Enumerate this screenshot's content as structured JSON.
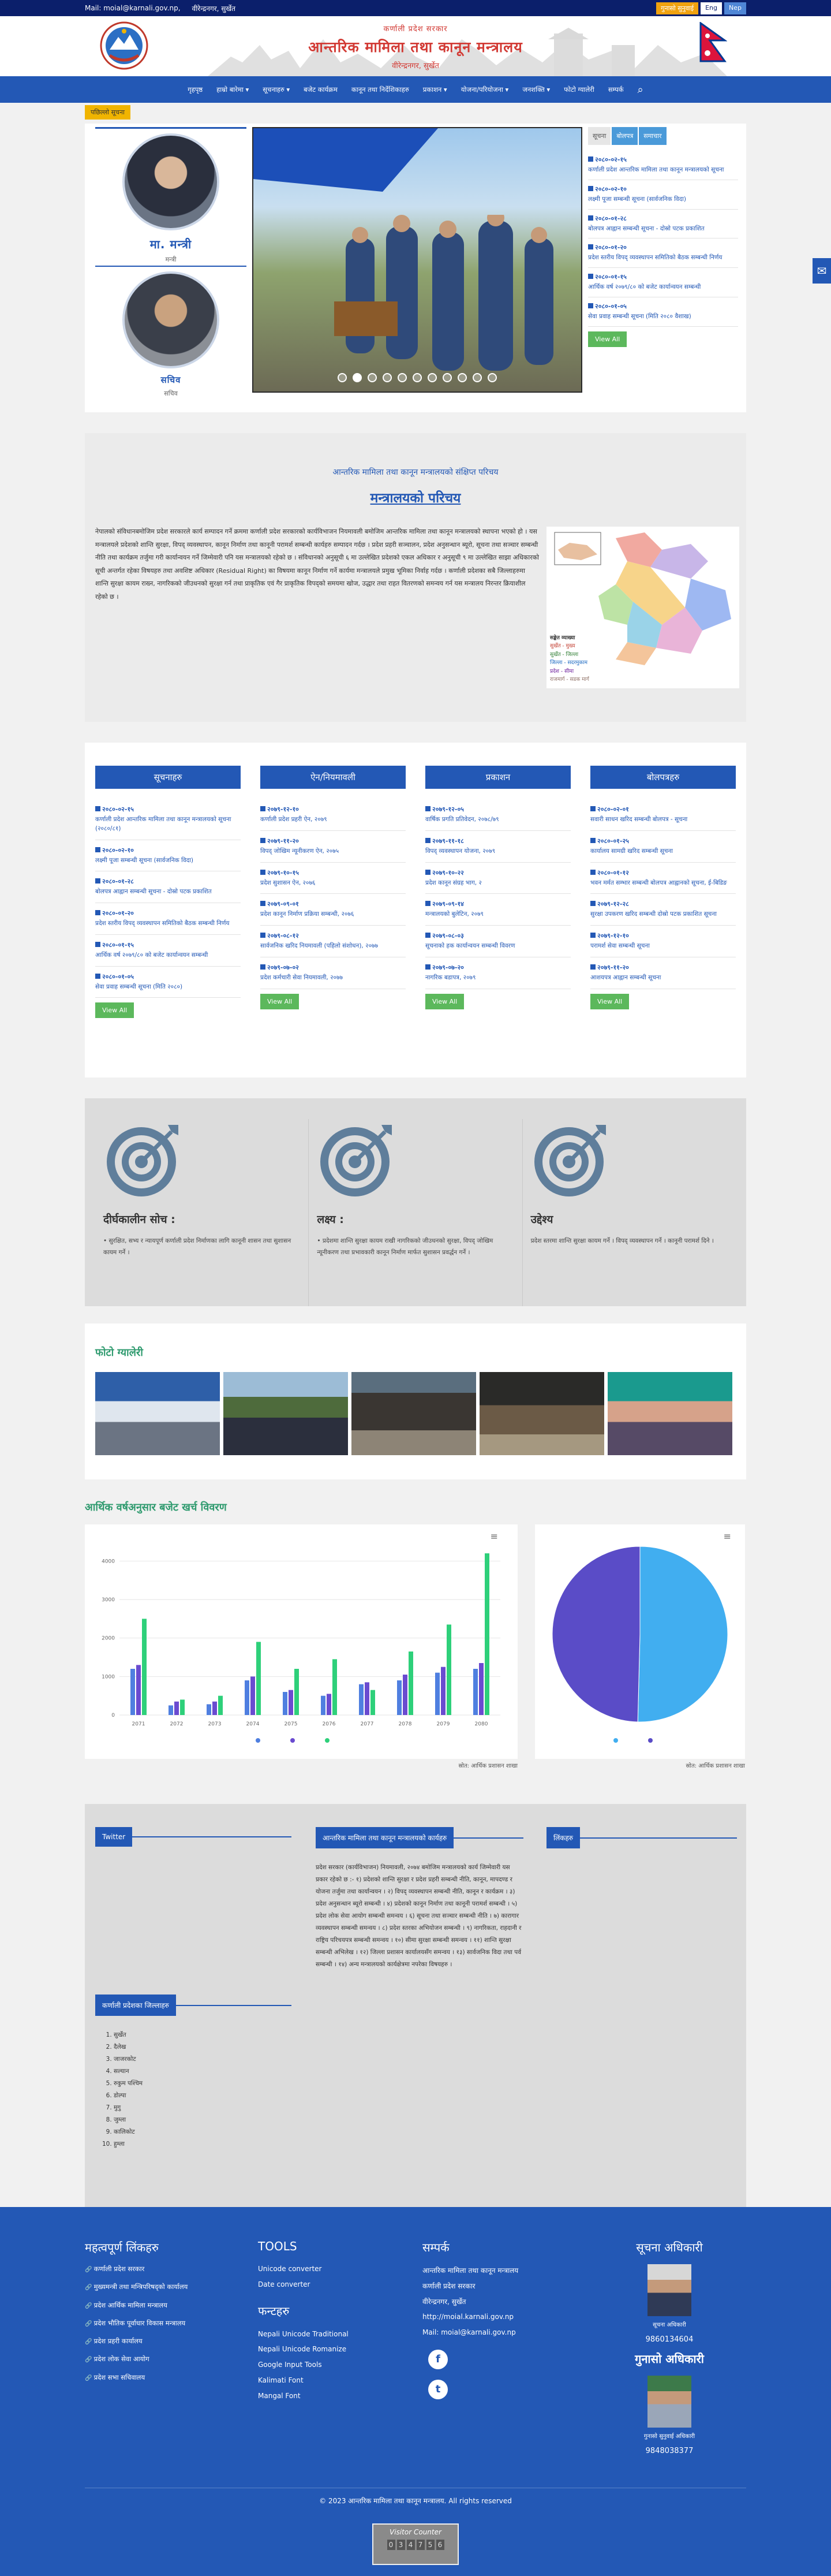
{
  "topbar": {
    "mail": "Mail: moial@karnali.gov.np,",
    "address": "वीरेन्द्रनगर, सुर्खेत",
    "orange_btn": "गुनासो सुनुवाई",
    "eng": "Eng",
    "nep": "Nep"
  },
  "header": {
    "line1": "कर्णाली प्रदेश सरकार",
    "line2": "आन्तरिक मामिला तथा कानून मन्त्रालय",
    "line3": "वीरेन्द्रनगर, सुर्खेत"
  },
  "nav": {
    "items": [
      "गृहपृष्ठ",
      "हाम्रो बारेमा ▾",
      "सूचनाहरु ▾",
      "बजेट कार्यक्रम",
      "कानून तथा निर्देशिकाहरु",
      "प्रकाशन ▾",
      "योजना/परियोजना ▾",
      "जनशक्ति ▾",
      "फोटो ग्यालेरी",
      "सम्पर्क"
    ],
    "search": "⌕"
  },
  "badge": "पछिल्लो सूचना",
  "officials": [
    {
      "name": "मा. मन्त्री",
      "role": "मन्त्री"
    },
    {
      "name": "सचिव",
      "role": "सचिव"
    }
  ],
  "tabs": [
    "सूचना",
    "बोलपत्र",
    "समाचार"
  ],
  "news_top": [
    {
      "date": "२०८०-०२-१५",
      "title": "कर्णाली प्रदेश आन्तरिक मामिला तथा कानून मन्त्रालयको सूचना"
    },
    {
      "date": "२०८०-०२-१०",
      "title": "लक्ष्मी पूजा सम्बन्धी सूचना (सार्वजनिक विदा)"
    },
    {
      "date": "२०८०-०१-२८",
      "title": "बोलपत्र आह्वान सम्बन्धी सूचना - दोस्रो पटक प्रकाशित"
    },
    {
      "date": "२०८०-०१-२०",
      "title": "प्रदेश स्तरीय विपद् व्यवस्थापन समितिको बैठक सम्बन्धी निर्णय"
    },
    {
      "date": "२०८०-०१-१५",
      "title": "आर्थिक वर्ष २०७९/८० को बजेट कार्यान्वयन सम्बन्धी"
    },
    {
      "date": "२०८०-०१-०५",
      "title": "सेवा प्रवाह सम्बन्धी सूचना (मिति २०८० वैशाख)"
    }
  ],
  "view_all": "View All",
  "intro": {
    "sub": "आन्तरिक मामिला तथा कानून मन्त्रालयको संक्षिप्त परिचय",
    "heading": "मन्त्रालयको परिचय",
    "body": "नेपालको संविधानबमोजिम प्रदेश सरकारले कार्य सम्पादन गर्ने क्रममा कर्णाली प्रदेश सरकारको कार्यविभाजन नियमावली बमोजिम आन्तरिक मामिला तथा कानून मन्त्रालयको स्थापना भएको हो । यस मन्त्रालयले प्रदेशको शान्ति सुरक्षा, विपद् व्यवस्थापन, कानून निर्माण तथा कानूनी परामर्श सम्बन्धी कार्यहरु सम्पादन गर्दछ । प्रदेश प्रहरी सञ्चालन, प्रदेश अनुसन्धान ब्यूरो, सूचना तथा सञ्चार सम्बन्धी नीति तथा कार्यक्रम तर्जुमा गरी कार्यान्वयन गर्ने जिम्मेवारी पनि यस मन्त्रालयको रहेको छ । संविधानको अनुसूची ६ मा उल्लेखित प्रदेशको एकल अधिकार र अनुसूची ९ मा उल्लेखित साझा अधिकारको सूची अन्तर्गत रहेका विषयहरु तथा अवशिष्ट अधिकार (Residual Right) का विषयमा कानून निर्माण गर्ने कार्यमा मन्त्रालयले प्रमुख भूमिका निर्वाह गर्दछ । कर्णाली प्रदेशका सबै जिल्लाहरुमा शान्ति सुरक्षा कायम राख्न, नागरिकको जीउधनको सुरक्षा गर्न तथा प्राकृतिक एवं गैर प्राकृतिक विपद्को समयमा खोज, उद्धार तथा राहत वितरणको समन्वय गर्न यस मन्त्रालय निरन्तर क्रियाशील रहेको छ ।"
  },
  "map_legend": {
    "title": "सङ्केत व्याख्या",
    "items": [
      "सुर्खेत - मुख्य",
      "सुर्खेत - जिल्ला",
      "जिल्ला - सदरमुकाम",
      "प्रदेश - सीमा",
      "राजमार्ग - सडक मार्ग"
    ]
  },
  "columns": [
    {
      "title": "सूचनाहरु",
      "items": [
        {
          "date": "२०८०-०२-१५",
          "title": "कर्णाली प्रदेश आन्तरिक मामिला तथा कानून मन्त्रालयको सूचना (२०८०/८१)"
        },
        {
          "date": "२०८०-०२-१०",
          "title": "लक्ष्मी पूजा सम्बन्धी सूचना (सार्वजनिक विदा)"
        },
        {
          "date": "२०८०-०१-२८",
          "title": "बोलपत्र आह्वान सम्बन्धी सूचना - दोस्रो पटक प्रकाशित"
        },
        {
          "date": "२०८०-०१-२०",
          "title": "प्रदेश स्तरीय विपद् व्यवस्थापन समितिको बैठक सम्बन्धी निर्णय"
        },
        {
          "date": "२०८०-०१-१५",
          "title": "आर्थिक वर्ष २०७९/८० को बजेट कार्यान्वयन सम्बन्धी"
        },
        {
          "date": "२०८०-०१-०५",
          "title": "सेवा प्रवाह सम्बन्धी सूचना (मिति २०८०)"
        }
      ]
    },
    {
      "title": "ऐन/नियमावली",
      "items": [
        {
          "date": "२०७९-१२-१०",
          "title": "कर्णाली प्रदेश प्रहरी ऐन, २०७९"
        },
        {
          "date": "२०७९-११-२०",
          "title": "विपद् जोखिम न्यूनीकरण ऐन, २०७५"
        },
        {
          "date": "२०७९-१०-१५",
          "title": "प्रदेश सुशासन ऐन, २०७६"
        },
        {
          "date": "२०७९-०९-०१",
          "title": "प्रदेश कानून निर्माण प्रक्रिया सम्बन्धी, २०७६"
        },
        {
          "date": "२०७९-०८-१२",
          "title": "सार्वजनिक खरिद नियमावली (पहिलो संशोधन), २०७७"
        },
        {
          "date": "२०७९-०७-०२",
          "title": "प्रदेश कर्मचारी सेवा नियमावली, २०७७"
        }
      ]
    },
    {
      "title": "प्रकाशन",
      "items": [
        {
          "date": "२०७९-१२-०५",
          "title": "वार्षिक प्रगति प्रतिवेदन, २०७८/७९"
        },
        {
          "date": "२०७९-११-१८",
          "title": "विपद् व्यवस्थापन योजना, २०७९"
        },
        {
          "date": "२०७९-१०-२२",
          "title": "प्रदेश कानून संग्रह भाग, २"
        },
        {
          "date": "२०७९-०९-१४",
          "title": "मन्त्रालयको बुलेटिन, २०७९"
        },
        {
          "date": "२०७९-०८-०३",
          "title": "सूचनाको हक कार्यान्वयन सम्बन्धी विवरण"
        },
        {
          "date": "२०७९-०७-२०",
          "title": "नागरिक बडापत्र, २०७९"
        }
      ]
    },
    {
      "title": "बोलपत्रहरु",
      "items": [
        {
          "date": "२०८०-०२-०१",
          "title": "सवारी साधन खरिद सम्बन्धी बोलपत्र - सूचना"
        },
        {
          "date": "२०८०-०१-२५",
          "title": "कार्यालय सामग्री खरिद सम्बन्धी सूचना"
        },
        {
          "date": "२०८०-०१-१२",
          "title": "भवन मर्मत सम्भार सम्बन्धी बोलपत्र आह्वानको सूचना, ई-बिडिङ"
        },
        {
          "date": "२०७९-१२-२८",
          "title": "सुरक्षा उपकरण खरिद सम्बन्धी दोस्रो पटक प्रकाशित सूचना"
        },
        {
          "date": "२०७९-१२-१०",
          "title": "परामर्श सेवा सम्बन्धी सूचना"
        },
        {
          "date": "२०७९-११-२०",
          "title": "आशयपत्र आह्वान सम्बन्धी सूचना"
        }
      ]
    }
  ],
  "goals": [
    {
      "heading": "दीर्घकालीन सोच :",
      "text": "• सुरक्षित, सभ्य र न्यायपूर्ण कर्णाली प्रदेश निर्माणका लागि कानूनी शासन तथा सुशासन कायम गर्ने ।"
    },
    {
      "heading": "लक्ष्य :",
      "text": "• प्रदेशमा शान्ति सुरक्षा कायम राखी नागरिकको जीउधनको सुरक्षा, विपद् जोखिम न्यूनीकरण तथा प्रभावकारी कानून निर्माण मार्फत सुशासन प्रवर्द्धन गर्ने ।"
    },
    {
      "heading": "उद्देश्य",
      "text": "प्रदेश स्तरमा शान्ति सुरक्षा कायम गर्ने । विपद् व्यवस्थापन गर्ने । कानूनी परामर्श दिने ।"
    }
  ],
  "gallery": {
    "heading": "फोटो ग्यालेरी"
  },
  "charts_heading": "आर्थिक वर्षअनुसार बजेट खर्च विवरण",
  "chart_data": [
    {
      "type": "bar",
      "title": "",
      "categories": [
        "2071",
        "2072",
        "2073",
        "2074",
        "2075",
        "2076",
        "2077",
        "2078",
        "2079",
        "2080"
      ],
      "series": [
        {
          "name": "",
          "values": [
            1200,
            250,
            280,
            900,
            600,
            500,
            800,
            900,
            1100,
            1200
          ]
        },
        {
          "name": "",
          "values": [
            1300,
            350,
            350,
            1000,
            650,
            550,
            850,
            1050,
            1250,
            1350
          ]
        },
        {
          "name": "",
          "values": [
            2500,
            400,
            500,
            1900,
            1200,
            1450,
            650,
            1650,
            2350,
            4200
          ]
        }
      ],
      "ylim": [
        0,
        4500
      ],
      "yticks": [
        "0",
        "1000",
        "2000",
        "3000",
        "4000"
      ],
      "colors": [
        "#4f7fe0",
        "#6a4bd0",
        "#2ed07a"
      ],
      "legend_position": "bottom"
    },
    {
      "type": "pie",
      "title": "",
      "categories": [
        "",
        ""
      ],
      "values": [
        50.4,
        49.6
      ],
      "colors": [
        "#41aef0",
        "#5a4cc7"
      ],
      "legend_position": "bottom"
    }
  ],
  "chart_captions": [
    "स्रोत: आर्थिक प्रशासन शाखा",
    "स्रोत: आर्थिक प्रशासन शाखा"
  ],
  "widgets": {
    "twitter": "Twitter",
    "center": "आन्तरिक मामिला तथा कानून मन्त्रालयको कार्यहरु",
    "right": "लिंकहरु",
    "districts_head": "कर्णाली प्रदेशका जिल्लाहरु",
    "districts": [
      "सुर्खेत",
      "दैलेख",
      "जाजरकोट",
      "सल्यान",
      "रुकुम पश्चिम",
      "डोल्पा",
      "मुगु",
      "जुम्ला",
      "कालिकोट",
      "हुम्ला"
    ],
    "center_body": "प्रदेश सरकार (कार्यविभाजन) नियमावली, २०७४ बमोजिम मन्त्रालयको कार्य जिम्मेवारी यस प्रकार रहेको छ :- १) प्रदेशको शान्ति सुरक्षा र प्रदेश प्रहरी सम्बन्धी नीति, कानून, मापदण्ड र योजना तर्जुमा तथा कार्यान्वयन । २) विपद् व्यवस्थापन सम्बन्धी नीति, कानून र कार्यक्रम । ३) प्रदेश अनुसन्धान ब्यूरो सम्बन्धी । ४) प्रदेशको कानून निर्माण तथा कानूनी परामर्श सम्बन्धी । ५) प्रदेश लोक सेवा आयोग सम्बन्धी समन्वय । ६) सूचना तथा सञ्चार सम्बन्धी नीति । ७) कारागार व्यवस्थापन सम्बन्धी समन्वय । ८) प्रदेश स्तरका अभियोजन सम्बन्धी । ९) नागरिकता, राहदानी र राष्ट्रिय परिचयपत्र सम्बन्धी समन्वय । १०) सीमा सुरक्षा सम्बन्धी समन्वय । ११) शान्ति सुरक्षा सम्बन्धी अभिलेख । १२) जिल्ला प्रशासन कार्यालयसँग समन्वय । १३) सार्वजनिक विदा तथा पर्व सम्बन्धी । १४) अन्य मन्त्रालयको कार्यक्षेत्रमा नपरेका विषयहरु ।"
  },
  "footer": {
    "c1_head": "महत्वपूर्ण लिंकहरु",
    "c1": [
      "कर्णाली प्रदेश सरकार",
      "मुख्यमन्त्री तथा मन्त्रिपरिषद्को कार्यालय",
      "प्रदेश आर्थिक मामिला मन्त्रालय",
      "प्रदेश भौतिक पूर्वाधार विकास मन्त्रालय",
      "प्रदेश प्रहरी कार्यालय",
      "प्रदेश लोक सेवा आयोग",
      "प्रदेश सभा सचिवालय"
    ],
    "c2_head": "TOOLS",
    "c2": [
      "Unicode converter",
      "Date converter"
    ],
    "c2b_head": "फन्टहरु",
    "c2b": [
      "Nepali Unicode Traditional",
      "Nepali Unicode Romanize",
      "Google Input Tools",
      "Kalimati Font",
      "Mangal Font"
    ],
    "c3_head": "सम्पर्क",
    "c3": [
      "आन्तरिक मामिला तथा कानून मन्त्रालय",
      "कर्णाली प्रदेश सरकार",
      "वीरेन्द्रनगर, सुर्खेत",
      "http://moial.karnali.gov.np",
      "Mail: moial@karnali.gov.np"
    ],
    "c4_head": "सूचना अधिकारी",
    "p1_name": "सूचना अधिकारी",
    "p1_phone": "9860134604",
    "c4b_head": "गुनासो अधिकारी",
    "p2_name": "गुनासो सुनुवाई अधिकारी",
    "p2_phone": "9848038377",
    "copyright": "© 2023 आन्तरिक मामिला तथा कानून मन्त्रालय. All rights reserved",
    "counter_title": "Visitor Counter",
    "counter_digits": [
      "0",
      "3",
      "4",
      "7",
      "5",
      "6"
    ]
  }
}
